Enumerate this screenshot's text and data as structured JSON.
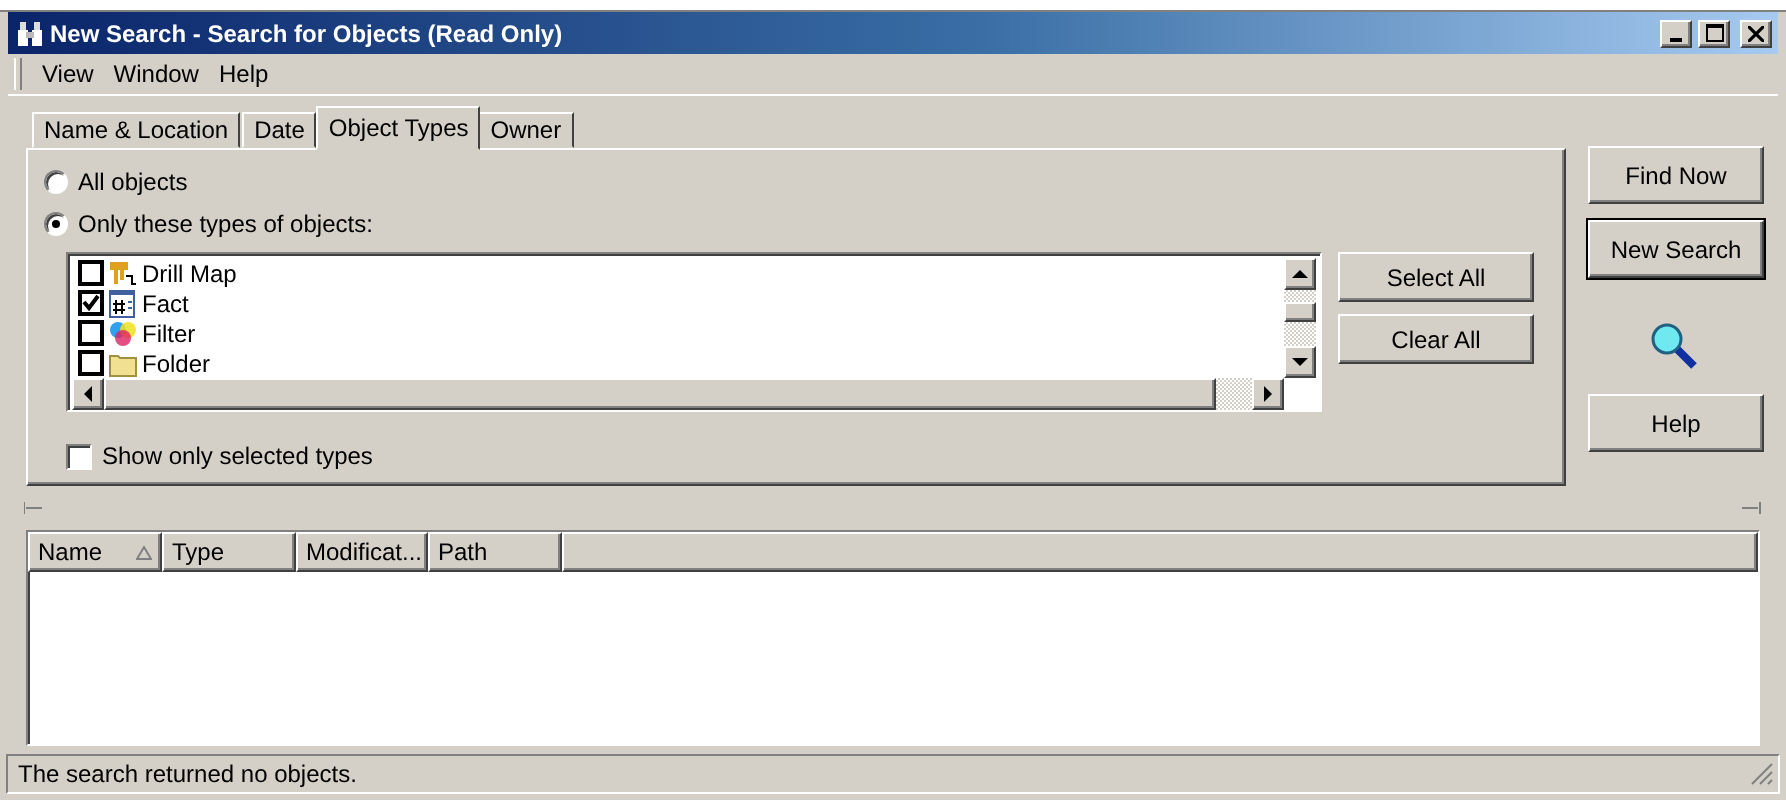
{
  "window": {
    "title": "New Search - Search for Objects (Read Only)"
  },
  "menu": [
    "View",
    "Window",
    "Help"
  ],
  "tabs": [
    {
      "label": "Name & Location",
      "selected": false
    },
    {
      "label": "Date",
      "selected": false
    },
    {
      "label": "Object Types",
      "selected": true
    },
    {
      "label": "Owner",
      "selected": false
    }
  ],
  "scope_options": [
    {
      "label": "All objects",
      "selected": false
    },
    {
      "label": "Only these types of objects:",
      "selected": true
    }
  ],
  "object_types": [
    {
      "label": "Drill Map",
      "kind": "drillmap",
      "checked": false
    },
    {
      "label": "Fact",
      "kind": "fact",
      "checked": true
    },
    {
      "label": "Filter",
      "kind": "filter",
      "checked": false
    },
    {
      "label": "Folder",
      "kind": "folder",
      "checked": false
    }
  ],
  "list_buttons": [
    "Select All",
    "Clear All"
  ],
  "show_only_selected": {
    "label": "Show only selected types",
    "checked": false
  },
  "action_buttons": [
    {
      "label": "Find Now",
      "default": false
    },
    {
      "label": "New Search",
      "default": true
    }
  ],
  "help_button": "Help",
  "results": {
    "columns": [
      {
        "label": "Name",
        "sorted": true
      },
      {
        "label": "Type"
      },
      {
        "label": "Modificat..."
      },
      {
        "label": "Path"
      }
    ]
  },
  "status_bar": "The search returned no objects."
}
